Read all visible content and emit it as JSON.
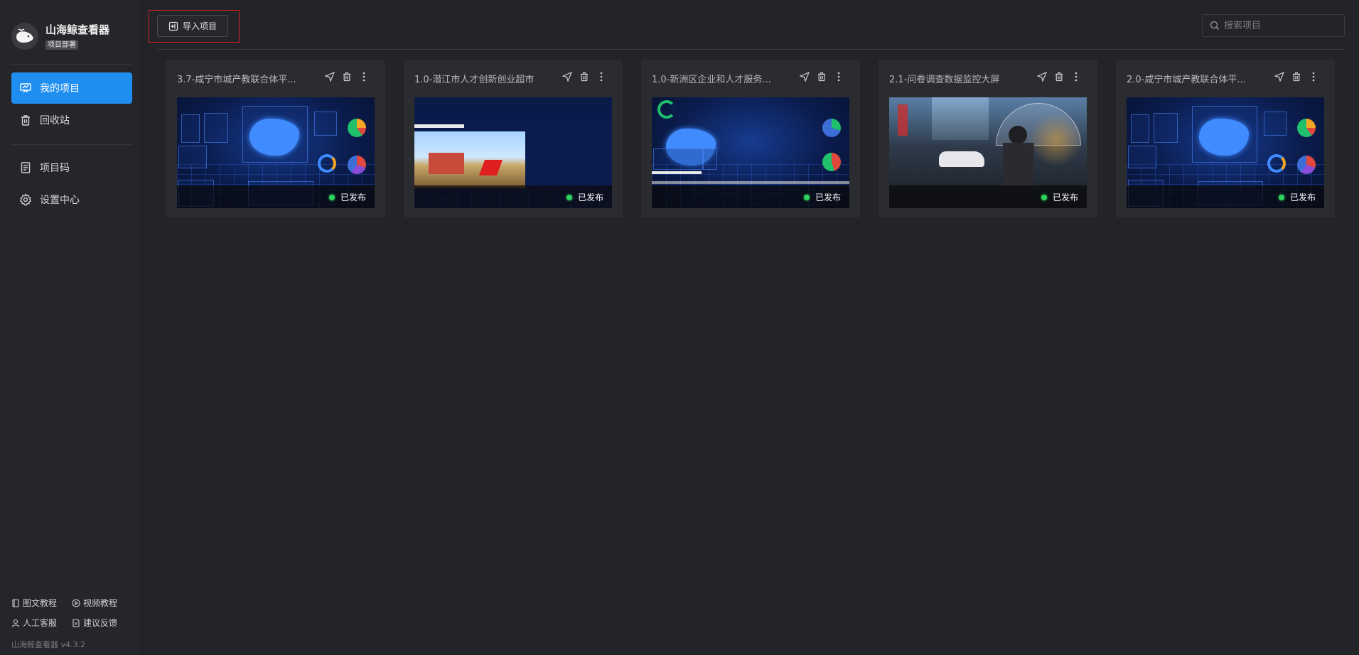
{
  "app": {
    "name": "山海鲸查看器",
    "badge": "项目部署",
    "version": "山海鲸查看器 v4.3.2"
  },
  "sidebar": {
    "items": [
      {
        "label": "我的项目",
        "icon": "project-board-icon",
        "active": true
      },
      {
        "label": "回收站",
        "icon": "trash-icon",
        "active": false
      },
      {
        "label": "项目码",
        "icon": "document-code-icon",
        "active": false
      },
      {
        "label": "设置中心",
        "icon": "gear-icon",
        "active": false
      }
    ],
    "footer": {
      "graphic_tutorial": "图文教程",
      "video_tutorial": "视频教程",
      "customer_service": "人工客服",
      "feedback": "建议反馈"
    }
  },
  "toolbar": {
    "import_label": "导入项目",
    "search_placeholder": "搜索项目"
  },
  "projects": [
    {
      "title": "3.7-咸宁市城产教联合体平...",
      "status": "已发布",
      "thumb": "dashboard"
    },
    {
      "title": "1.0-潜江市人才创新创业超市",
      "status": "已发布",
      "thumb": "city-photo"
    },
    {
      "title": "1.0-新洲区企业和人才服务...",
      "status": "已发布",
      "thumb": "dashboard"
    },
    {
      "title": "2.1-问卷调查数据监控大屏",
      "status": "已发布",
      "thumb": "anime-photo"
    },
    {
      "title": "2.0-咸宁市城产教联合体平...",
      "status": "已发布",
      "thumb": "dashboard"
    }
  ],
  "colors": {
    "accent": "#1f8ef1",
    "published": "#2bd45a",
    "highlight": "#d32020"
  }
}
